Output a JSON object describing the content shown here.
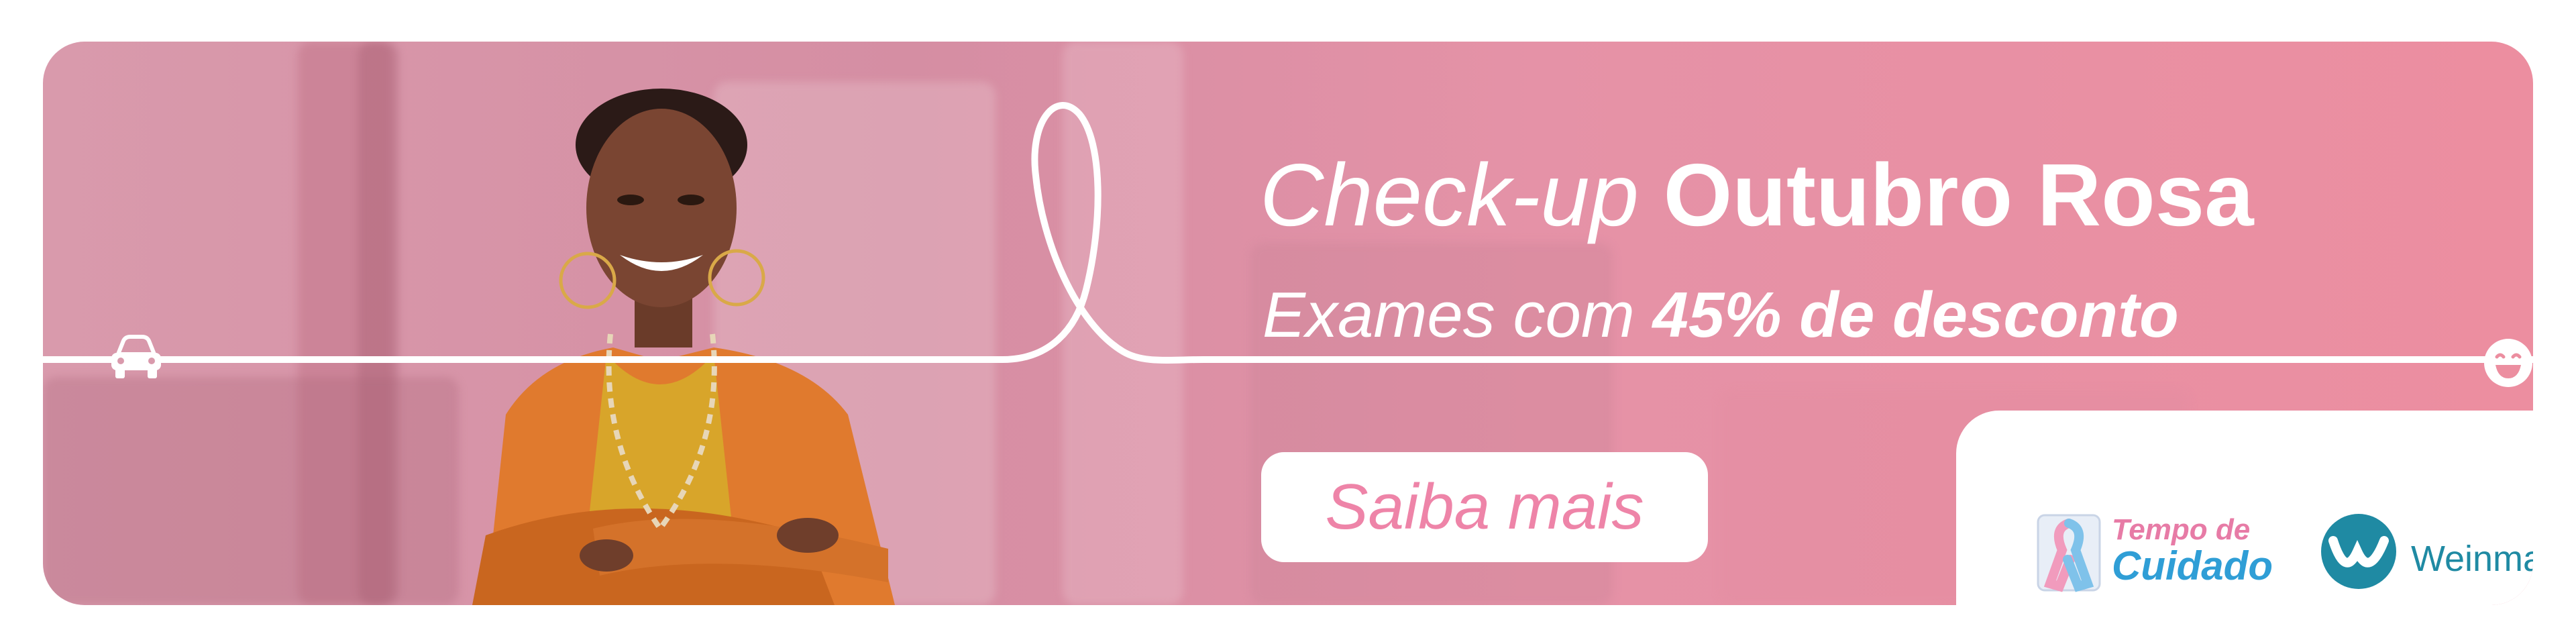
{
  "headline": {
    "light": "Check-up ",
    "bold": "Outubro Rosa"
  },
  "subheadline": {
    "light": "Exames com ",
    "bold": "45% de desconto"
  },
  "cta": {
    "label": "Saiba mais"
  },
  "logos": {
    "tempo_line1": "Tempo de",
    "tempo_line2": "Cuidado",
    "weinmann": "Weinmann"
  },
  "icons": {
    "left": "car-icon",
    "right": "smile-icon",
    "ribbon": "pink-blue-ribbon-icon",
    "brand": "weinmann-w-icon"
  },
  "colors": {
    "banner_pink": "#e592a7",
    "cta_text": "#ee84a8",
    "tempo_pink": "#e77ba6",
    "tempo_blue": "#2f9ed6",
    "weinmann_teal": "#1f8aa3"
  }
}
